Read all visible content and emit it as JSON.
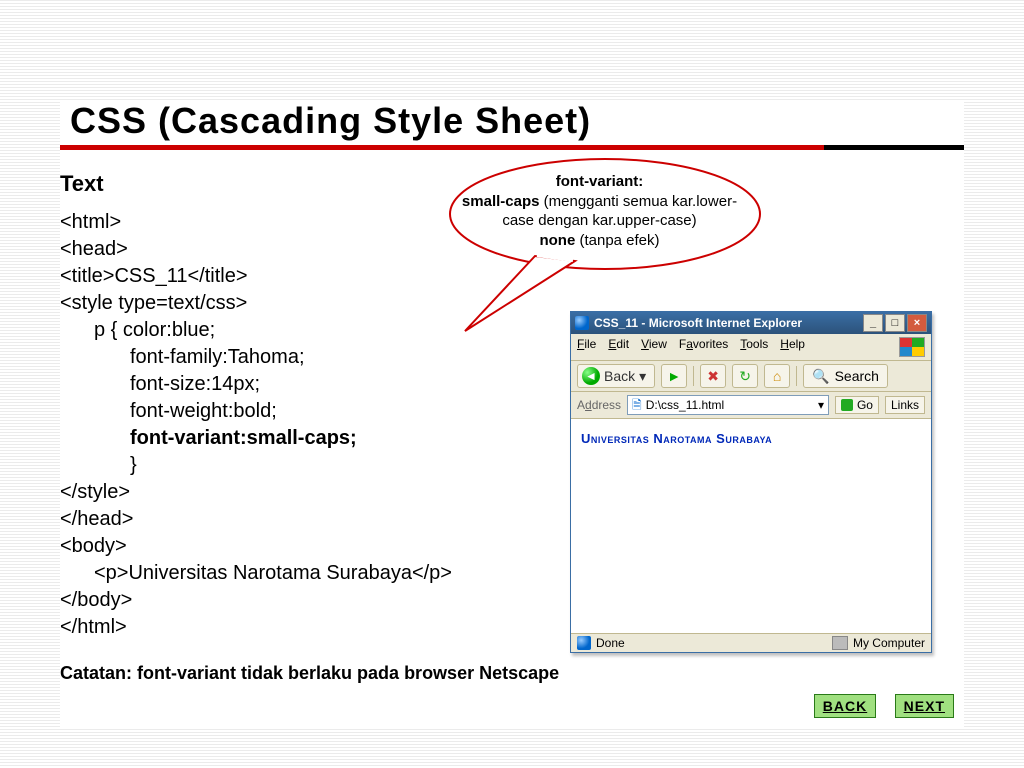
{
  "title": "CSS (Cascading Style Sheet)",
  "section_heading": "Text",
  "code": {
    "l1": "<html>",
    "l2": "<head>",
    "l3": "<title>CSS_11</title>",
    "l4": "<style type=text/css>",
    "l5a": "p {  color:blue;",
    "l5b": "font-family:Tahoma;",
    "l5c": "font-size:14px;",
    "l5d": "font-weight:bold;",
    "l5e": "font-variant:small-caps;",
    "l5f": "}",
    "l6": "</style>",
    "l7": "</head>",
    "l8": "<body>",
    "l9": "<p>Universitas Narotama Surabaya</p>",
    "l10": "</body>",
    "l11": "</html>"
  },
  "callout": {
    "line1a": "font-variant:",
    "line2a": "small-caps ",
    "line2b": "(mengganti semua kar.lower-case dengan kar.upper-case)",
    "line3a": "none ",
    "line3b": "(tanpa efek)"
  },
  "footnote": "Catatan: font-variant tidak berlaku pada browser Netscape",
  "nav": {
    "back": "BACK",
    "next": "NEXT"
  },
  "browser": {
    "title": "CSS_11 - Microsoft Internet Explorer",
    "menus": {
      "file": "File",
      "edit": "Edit",
      "view": "View",
      "favorites": "Favorites",
      "tools": "Tools",
      "help": "Help"
    },
    "back": "Back",
    "search": "Search",
    "address_label": "Address",
    "address_value": "D:\\css_11.html",
    "go": "Go",
    "links": "Links",
    "rendered_text": "Universitas Narotama Surabaya",
    "status_done": "Done",
    "status_zone": "My Computer"
  }
}
